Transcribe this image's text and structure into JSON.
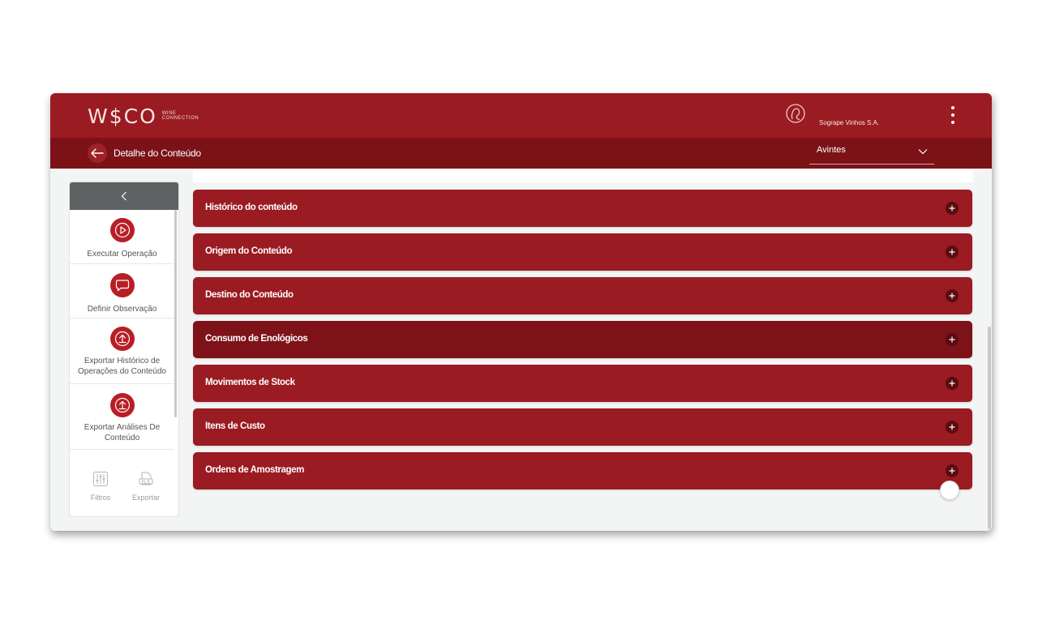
{
  "header": {
    "logo_text": "W$CO",
    "logo_sub_line1": "WINE",
    "logo_sub_line2": "CONNECTION",
    "company_icon": "company-logo-icon",
    "company_name": "Sogrape Vinhos S.A.",
    "menu_icon": "kebab-menu-icon"
  },
  "subheader": {
    "back_icon": "arrow-left-icon",
    "title": "Detalhe do Conteúdo",
    "location_select": {
      "value": "Avintes",
      "icon": "chevron-down-icon"
    }
  },
  "sidebar": {
    "collapse_icon": "chevron-left-icon",
    "items": [
      {
        "label": "Executar Operação",
        "icon": "play-icon"
      },
      {
        "label": "Definir Observação",
        "icon": "comment-icon"
      },
      {
        "label": "Exportar Histórico de Operações do Conteúdo",
        "icon": "upload-icon"
      },
      {
        "label": "Exportar Análises De Conteúdo",
        "icon": "upload-icon"
      }
    ],
    "tools": [
      {
        "label": "Filtros",
        "icon": "filter-sliders-icon"
      },
      {
        "label": "Exportar",
        "icon": "xls-file-icon"
      }
    ]
  },
  "accordion": {
    "items": [
      {
        "label": "Histórico do conteúdo",
        "expanded": false
      },
      {
        "label": "Origem do Conteúdo",
        "expanded": false
      },
      {
        "label": "Destino do Conteúdo",
        "expanded": false
      },
      {
        "label": "Consumo de Enológicos",
        "expanded": false,
        "hovered": true
      },
      {
        "label": "Movimentos de Stock",
        "expanded": false
      },
      {
        "label": "Itens de Custo",
        "expanded": false
      },
      {
        "label": "Ordens de Amostragem",
        "expanded": false
      }
    ],
    "expand_icon": "plus-icon"
  },
  "colors": {
    "primary": "#9a1b21",
    "primary_dark": "#7b1217",
    "accent_icon": "#b81e26",
    "sidebar_header": "#5f6163",
    "background": "#f3f4f4"
  }
}
